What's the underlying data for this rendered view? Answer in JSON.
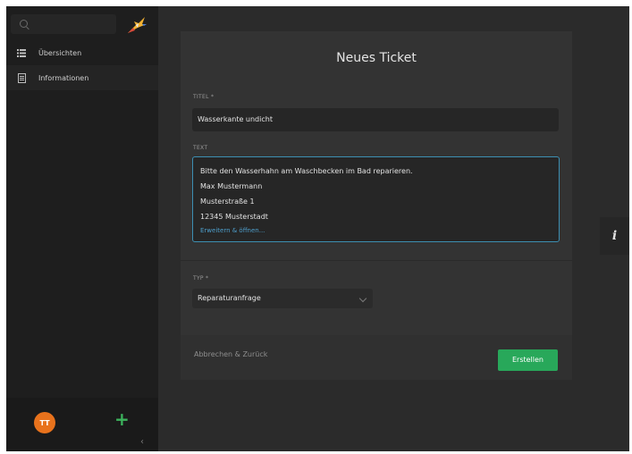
{
  "sidebar": {
    "search_placeholder": "",
    "items": [
      {
        "label": "Übersichten",
        "icon": "list-icon"
      },
      {
        "label": "Informationen",
        "icon": "document-icon"
      }
    ],
    "user_initials": "TT",
    "logo": "bird-logo",
    "add_icon": "plus-icon",
    "collapse_icon": "chevron-left-icon"
  },
  "form": {
    "title": "Neues Ticket",
    "titel_label": "TITEL *",
    "titel_value": "Wasserkante undicht",
    "text_label": "TEXT",
    "text_lines": [
      "Bitte den Wasserhahn am Waschbecken im Bad reparieren.",
      "Max Mustermann",
      "Musterstraße 1",
      "12345 Musterstadt"
    ],
    "expand_label": "Erweitern & öffnen...",
    "typ_label": "TYP *",
    "typ_value": "Reparaturanfrage",
    "cancel_label": "Abbrechen & Zurück",
    "submit_label": "Erstellen"
  },
  "info_icon": "info-icon",
  "colors": {
    "accent_green": "#28a85a",
    "avatar_orange": "#e8721c",
    "focus_blue": "#3d8fb2"
  }
}
